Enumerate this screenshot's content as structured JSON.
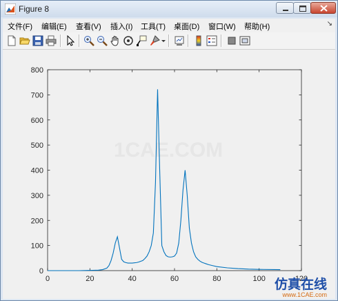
{
  "window": {
    "title": "Figure 8"
  },
  "menus": [
    "文件(F)",
    "编辑(E)",
    "查看(V)",
    "插入(I)",
    "工具(T)",
    "桌面(D)",
    "窗口(W)",
    "帮助(H)"
  ],
  "toolbar": {
    "icons": [
      "new-figure-icon",
      "open-file-icon",
      "save-icon",
      "print-icon",
      "pointer-icon",
      "zoom-in-icon",
      "zoom-out-icon",
      "pan-hand-icon",
      "rotate-3d-icon",
      "data-cursor-icon",
      "brush-icon",
      "brush-dropdown-icon",
      "link-plot-icon",
      "colorbar-icon",
      "legend-icon",
      "hide-plot-tools-icon",
      "show-plot-tools-icon"
    ]
  },
  "watermark": "1CAE.COM",
  "logo": {
    "text": "仿真在线",
    "url": "www.1CAE.com"
  },
  "chart_data": {
    "type": "line",
    "title": "",
    "xlabel": "",
    "ylabel": "",
    "xlim": [
      0,
      120
    ],
    "ylim": [
      0,
      800
    ],
    "xticks": [
      0,
      20,
      40,
      60,
      80,
      100,
      120
    ],
    "yticks": [
      0,
      100,
      200,
      300,
      400,
      500,
      600,
      700,
      800
    ],
    "grid": false,
    "line_color": "#0072bd",
    "series": [
      {
        "x": [
          0,
          5,
          10,
          15,
          20,
          24,
          26,
          28,
          29,
          30,
          31,
          32,
          33,
          34,
          35,
          36,
          37,
          38,
          39,
          40,
          41,
          42,
          43,
          44,
          45,
          46,
          47,
          48,
          49,
          50,
          51,
          52,
          53,
          54,
          55,
          56,
          57,
          58,
          59,
          60,
          61,
          62,
          63,
          64,
          65,
          66,
          67,
          68,
          69,
          70,
          71,
          72,
          73,
          74,
          75,
          76,
          78,
          80,
          85,
          90,
          95,
          100,
          110
        ],
        "y": [
          0,
          0,
          0,
          0,
          1,
          2,
          4,
          10,
          20,
          40,
          70,
          110,
          135,
          90,
          45,
          35,
          32,
          30,
          30,
          30,
          31,
          32,
          34,
          37,
          40,
          48,
          58,
          75,
          100,
          150,
          350,
          722,
          400,
          100,
          75,
          60,
          55,
          54,
          55,
          58,
          70,
          110,
          200,
          320,
          400,
          300,
          170,
          110,
          75,
          55,
          45,
          38,
          33,
          30,
          27,
          24,
          20,
          16,
          11,
          8,
          6,
          5,
          4
        ]
      }
    ]
  }
}
